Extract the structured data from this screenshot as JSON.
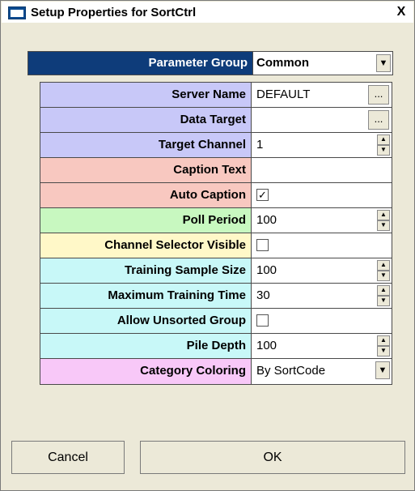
{
  "window": {
    "title": "Setup Properties for SortCtrl",
    "close_label": "X"
  },
  "parameter_group": {
    "label": "Parameter Group",
    "value": "Common",
    "arrow": "▼"
  },
  "rows": [
    {
      "label": "Server Name",
      "value": "DEFAULT",
      "control": "ellipsis",
      "button": "..."
    },
    {
      "label": "Data Target",
      "value": "",
      "control": "ellipsis",
      "button": "..."
    },
    {
      "label": "Target Channel",
      "value": "1",
      "control": "spinner"
    },
    {
      "label": "Caption Text",
      "value": "",
      "control": "text"
    },
    {
      "label": "Auto Caption",
      "checked": true,
      "control": "checkbox"
    },
    {
      "label": "Poll Period",
      "value": "100",
      "control": "spinner"
    },
    {
      "label": "Channel Selector Visible",
      "checked": false,
      "control": "checkbox"
    },
    {
      "label": "Training Sample Size",
      "value": "100",
      "control": "spinner"
    },
    {
      "label": "Maximum Training Time",
      "value": "30",
      "control": "spinner"
    },
    {
      "label": "Allow Unsorted Group",
      "checked": false,
      "control": "checkbox"
    },
    {
      "label": "Pile Depth",
      "value": "100",
      "control": "spinner"
    },
    {
      "label": "Category Coloring",
      "value": "By SortCode",
      "control": "dropdown",
      "arrow": "▼"
    }
  ],
  "glyphs": {
    "check": "✓",
    "spin_up": "▲",
    "spin_down": "▼"
  },
  "buttons": {
    "cancel": "Cancel",
    "ok": "OK"
  },
  "colors": {
    "group_header": "#0e3c7a",
    "server_group": "#c8c8f8",
    "caption_group": "#f8c8c0",
    "poll_group": "#c8f8c0",
    "selector_group": "#fff8c8",
    "training_group": "#c8f8f8",
    "coloring_group": "#f8c8f8"
  }
}
